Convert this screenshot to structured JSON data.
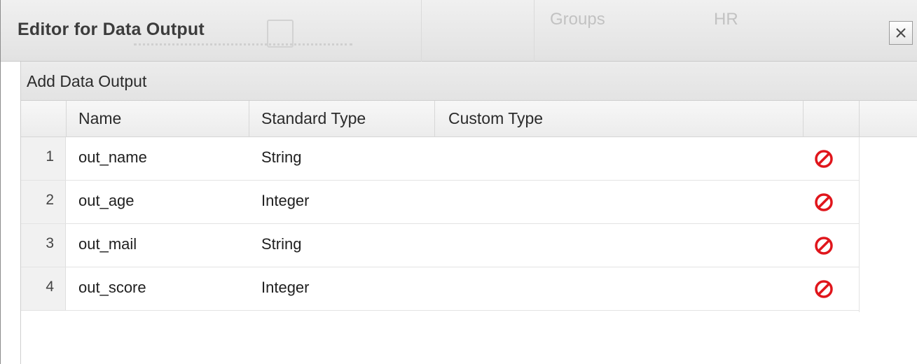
{
  "dialog": {
    "title": "Editor for Data Output",
    "background_labels": [
      "Groups",
      "HR"
    ]
  },
  "panel": {
    "title": "Add Data Output"
  },
  "grid": {
    "columns": [
      "Name",
      "Standard Type",
      "Custom Type"
    ],
    "rows": [
      {
        "num": "1",
        "name": "out_name",
        "standard_type": "String",
        "custom_type": ""
      },
      {
        "num": "2",
        "name": "out_age",
        "standard_type": "Integer",
        "custom_type": ""
      },
      {
        "num": "3",
        "name": "out_mail",
        "standard_type": "String",
        "custom_type": ""
      },
      {
        "num": "4",
        "name": "out_score",
        "standard_type": "Integer",
        "custom_type": ""
      }
    ]
  },
  "colors": {
    "delete_icon": "#e0161c",
    "title_text": "#3c3c3c"
  },
  "icons": {
    "close": "close-icon",
    "delete": "delete-icon"
  }
}
